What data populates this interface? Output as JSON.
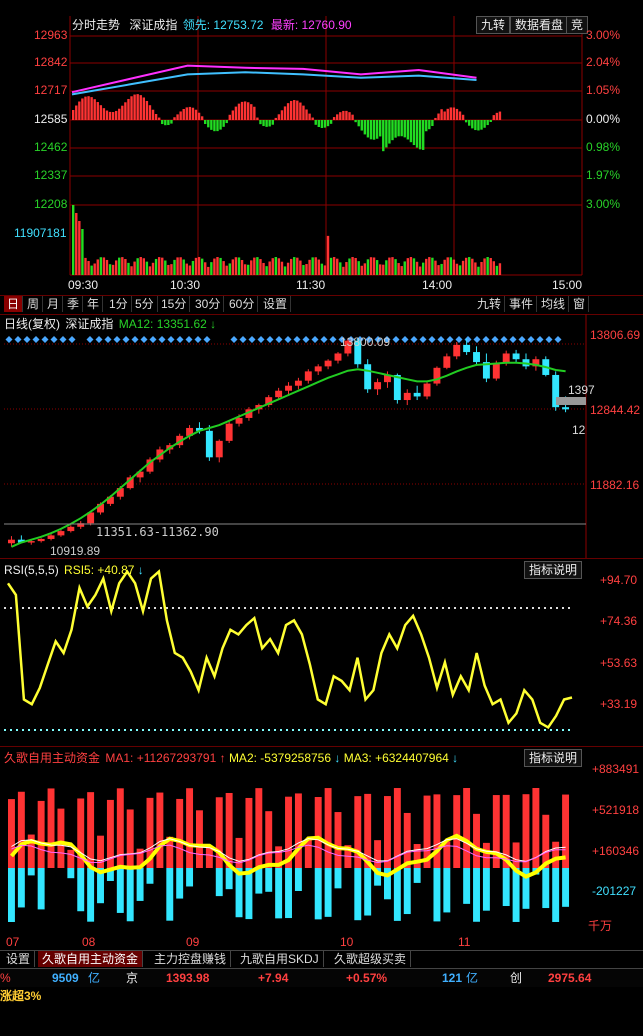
{
  "intraday": {
    "title": "分时走势",
    "name": "深证成指",
    "lead_label": "领先:",
    "lead_value": "12753.72",
    "latest_label": "最新:",
    "latest_value": "12760.90",
    "buttons": [
      "九转",
      "数据看盘",
      "竞"
    ],
    "price_ticks": [
      "12963",
      "12842",
      "12717",
      "12585",
      "12462",
      "12337",
      "12208"
    ],
    "pct_ticks": [
      "3.00%",
      "2.04%",
      "1.05%",
      "0.00%",
      "0.98%",
      "1.97%",
      "3.00%"
    ],
    "volume_tick": "11907181",
    "time_ticks": [
      "09:30",
      "10:30",
      "11:30",
      "14:00",
      "15:00"
    ]
  },
  "period_tabs": [
    "日",
    "周",
    "月",
    "季",
    "年",
    "1分",
    "5分",
    "15分",
    "30分",
    "60分",
    "设置"
  ],
  "active_period": "日",
  "right_tabs": [
    "九转",
    "事件",
    "均线",
    "窗"
  ],
  "kline": {
    "label": "日线(复权)",
    "name": "深证成指",
    "ma_label": "MA12:",
    "ma_value": "13351.62",
    "ma_arrow": "↓",
    "y_ticks": [
      "13806.69",
      "12844.42",
      "11882.16"
    ],
    "high_mark": "13800.09",
    "low_mark": "10919.89",
    "range_note": "11351.63-11362.90",
    "right_mark_1": "1397",
    "right_mark_2": "12"
  },
  "rsi": {
    "label": "RSI(5,5,5)",
    "value_label": "RSI5:",
    "value": "+40.87",
    "arrow": "↓",
    "btn": "指标说明",
    "y_ticks": [
      "+94.70",
      "+74.36",
      "+53.63",
      "+33.19"
    ]
  },
  "fund": {
    "label": "久歌自用主动资金",
    "ma1_label": "MA1:",
    "ma1_value": "+11267293791",
    "ma2_label": "MA2:",
    "ma2_value": "-5379258756",
    "ma3_label": "MA3:",
    "ma3_value": "+6324407964",
    "btn": "指标说明",
    "y_ticks": [
      "+883491",
      "+521918",
      "+160346",
      "-201227"
    ],
    "unit": "千万"
  },
  "date_ticks": [
    "07",
    "08",
    "09",
    "10",
    "11"
  ],
  "bottom_tabs": [
    "设置",
    "久歌自用主动资金",
    "主力控盘赚钱",
    "九歌自用SKDJ",
    "久歌超级买卖"
  ],
  "active_bottom_tab": "久歌自用主动资金",
  "status": {
    "pct_frag": "%",
    "amount": "9509",
    "amount_unit": "亿",
    "market2": "京",
    "price2": "1393.98",
    "change2": "+7.94",
    "pct2": "+0.57%",
    "amount2": "121",
    "amount2_unit": "亿",
    "market3": "创",
    "price3": "2975.64"
  },
  "footer_text": "涨超3%",
  "colors": {
    "up": "#ff3333",
    "down": "#33e6ff",
    "ma": "#22cc22",
    "rsi": "#ffff33",
    "grid": "#8b0000"
  },
  "chart_data": [
    {
      "type": "line",
      "title": "分时走势 深证成指",
      "x": [
        "09:30",
        "10:00",
        "10:30",
        "11:00",
        "11:30",
        "13:30",
        "14:00",
        "14:30",
        "15:00"
      ],
      "series": [
        {
          "name": "领先",
          "values": [
            12700,
            12745,
            12790,
            12800,
            12790,
            12775,
            12785,
            12765,
            null
          ]
        },
        {
          "name": "最新",
          "values": [
            12710,
            12770,
            12830,
            12820,
            12815,
            12790,
            12810,
            12775,
            null
          ]
        }
      ],
      "ylim": [
        12208,
        12963
      ]
    },
    {
      "type": "bar",
      "title": "日线(复权) 深证成指",
      "note": "candlestick",
      "ylim": [
        10800,
        13900
      ],
      "candles_ohlc": [
        [
          10950,
          11050,
          10900,
          11000
        ],
        [
          11000,
          11060,
          10950,
          10960
        ],
        [
          10960,
          10990,
          10930,
          10980
        ],
        [
          10980,
          11020,
          10960,
          11010
        ],
        [
          11010,
          11080,
          10990,
          11060
        ],
        [
          11060,
          11150,
          11040,
          11120
        ],
        [
          11120,
          11200,
          11100,
          11180
        ],
        [
          11180,
          11260,
          11150,
          11230
        ],
        [
          11230,
          11400,
          11200,
          11380
        ],
        [
          11380,
          11520,
          11350,
          11500
        ],
        [
          11500,
          11620,
          11470,
          11600
        ],
        [
          11600,
          11750,
          11560,
          11720
        ],
        [
          11720,
          11900,
          11700,
          11870
        ],
        [
          11870,
          11980,
          11800,
          11950
        ],
        [
          11950,
          12150,
          11920,
          12120
        ],
        [
          12120,
          12300,
          12080,
          12260
        ],
        [
          12260,
          12350,
          12200,
          12320
        ],
        [
          12320,
          12480,
          12280,
          12450
        ],
        [
          12450,
          12600,
          12400,
          12560
        ],
        [
          12560,
          12640,
          12480,
          12520
        ],
        [
          12520,
          12600,
          12100,
          12150
        ],
        [
          12150,
          12400,
          12080,
          12380
        ],
        [
          12380,
          12650,
          12350,
          12620
        ],
        [
          12620,
          12750,
          12580,
          12700
        ],
        [
          12700,
          12850,
          12660,
          12820
        ],
        [
          12820,
          12900,
          12760,
          12880
        ],
        [
          12880,
          13020,
          12850,
          12990
        ],
        [
          12990,
          13120,
          12950,
          13080
        ],
        [
          13080,
          13200,
          13020,
          13150
        ],
        [
          13150,
          13260,
          13100,
          13220
        ],
        [
          13220,
          13380,
          13180,
          13350
        ],
        [
          13350,
          13450,
          13300,
          13420
        ],
        [
          13420,
          13520,
          13380,
          13500
        ],
        [
          13500,
          13620,
          13460,
          13600
        ],
        [
          13600,
          13810,
          13560,
          13780
        ],
        [
          13780,
          13820,
          13400,
          13450
        ],
        [
          13450,
          13520,
          13050,
          13100
        ],
        [
          13100,
          13250,
          13020,
          13200
        ],
        [
          13200,
          13350,
          13120,
          13300
        ],
        [
          13300,
          13320,
          12900,
          12950
        ],
        [
          12950,
          13100,
          12880,
          13050
        ],
        [
          13050,
          13150,
          12950,
          13000
        ],
        [
          13000,
          13200,
          12960,
          13180
        ],
        [
          13180,
          13420,
          13150,
          13400
        ],
        [
          13400,
          13600,
          13380,
          13560
        ],
        [
          13560,
          13760,
          13520,
          13720
        ],
        [
          13720,
          13810,
          13580,
          13620
        ],
        [
          13620,
          13700,
          13450,
          13480
        ],
        [
          13480,
          13600,
          13200,
          13250
        ],
        [
          13250,
          13500,
          13220,
          13460
        ],
        [
          13460,
          13640,
          13430,
          13600
        ],
        [
          13600,
          13650,
          13480,
          13520
        ],
        [
          13520,
          13600,
          13380,
          13420
        ],
        [
          13420,
          13560,
          13360,
          13520
        ],
        [
          13520,
          13560,
          13280,
          13300
        ],
        [
          13300,
          13350,
          12800,
          12850
        ],
        [
          12850,
          13000,
          12780,
          12820
        ]
      ],
      "ma12": [
        10900,
        10960,
        11000,
        11040,
        11090,
        11150,
        11220,
        11300,
        11390,
        11490,
        11600,
        11720,
        11840,
        11960,
        12080,
        12180,
        12280,
        12370,
        12450,
        12520,
        12560,
        12600,
        12660,
        12720,
        12780,
        12840,
        12900,
        12960,
        13020,
        13080,
        13140,
        13200,
        13260,
        13310,
        13360,
        13380,
        13360,
        13330,
        13300,
        13270,
        13240,
        13210,
        13210,
        13240,
        13290,
        13350,
        13400,
        13440,
        13450,
        13460,
        13470,
        13470,
        13460,
        13440,
        13410,
        13370,
        13351.62
      ]
    },
    {
      "type": "line",
      "title": "RSI(5,5,5)",
      "series": [
        {
          "name": "RSI5",
          "values": [
            90,
            85,
            40,
            38,
            45,
            55,
            65,
            60,
            70,
            88,
            80,
            85,
            92,
            78,
            90,
            95,
            90,
            78,
            92,
            95,
            74,
            60,
            58,
            52,
            44,
            58,
            50,
            62,
            70,
            68,
            72,
            75,
            62,
            66,
            60,
            72,
            74,
            68,
            55,
            40,
            38,
            50,
            48,
            44,
            58,
            40,
            44,
            60,
            68,
            62,
            72,
            76,
            68,
            58,
            45,
            56,
            42,
            50,
            44,
            60,
            46,
            38,
            40,
            30,
            34,
            44,
            40,
            30,
            28,
            33,
            40,
            40.87
          ]
        }
      ],
      "ylim": [
        20,
        100
      ]
    }
  ]
}
